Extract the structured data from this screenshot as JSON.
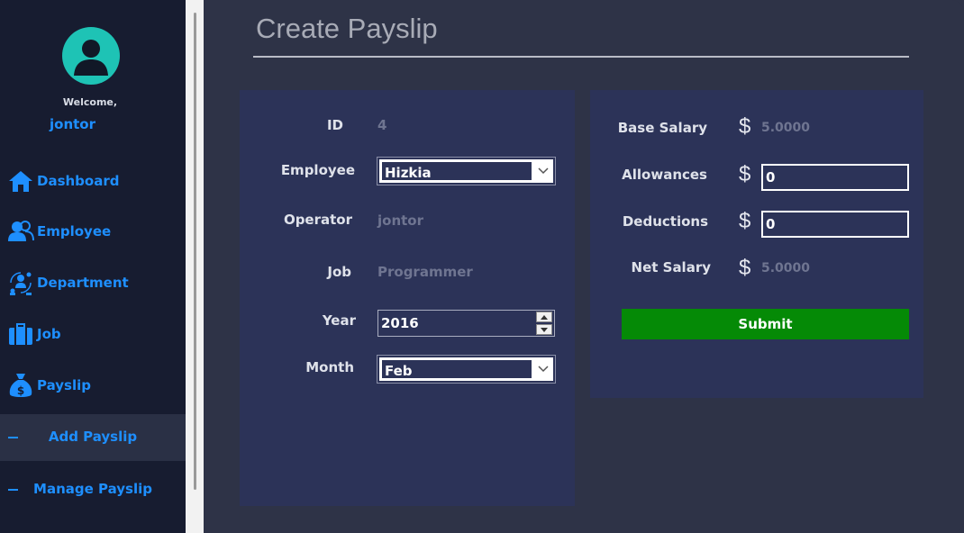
{
  "sidebar": {
    "welcome": "Welcome,",
    "username": "jontor",
    "items": [
      {
        "label": "Dashboard",
        "icon": "home-icon"
      },
      {
        "label": "Employee",
        "icon": "users-icon"
      },
      {
        "label": "Department",
        "icon": "department-icon"
      },
      {
        "label": "Job",
        "icon": "briefcase-icon"
      },
      {
        "label": "Payslip",
        "icon": "money-bag-icon"
      }
    ],
    "subitems": [
      {
        "label": "Add Payslip",
        "active": true
      },
      {
        "label": "Manage Payslip",
        "active": false
      }
    ]
  },
  "page": {
    "title": "Create Payslip"
  },
  "form": {
    "id_label": "ID",
    "id_value": "4",
    "employee_label": "Employee",
    "employee_value": "Hizkia",
    "operator_label": "Operator",
    "operator_value": "jontor",
    "job_label": "Job",
    "job_value": "Programmer",
    "year_label": "Year",
    "year_value": "2016",
    "month_label": "Month",
    "month_value": "Feb"
  },
  "salary": {
    "currency_symbol": "$",
    "base_label": "Base Salary",
    "base_value": "5.0000",
    "allowances_label": "Allowances",
    "allowances_value": "0",
    "deductions_label": "Deductions",
    "deductions_value": "0",
    "net_label": "Net Salary",
    "net_value": "5.0000",
    "submit_label": "Submit"
  },
  "colors": {
    "accent": "#1e8fff",
    "submit": "#058a06",
    "avatar": "#1ec3b5"
  }
}
